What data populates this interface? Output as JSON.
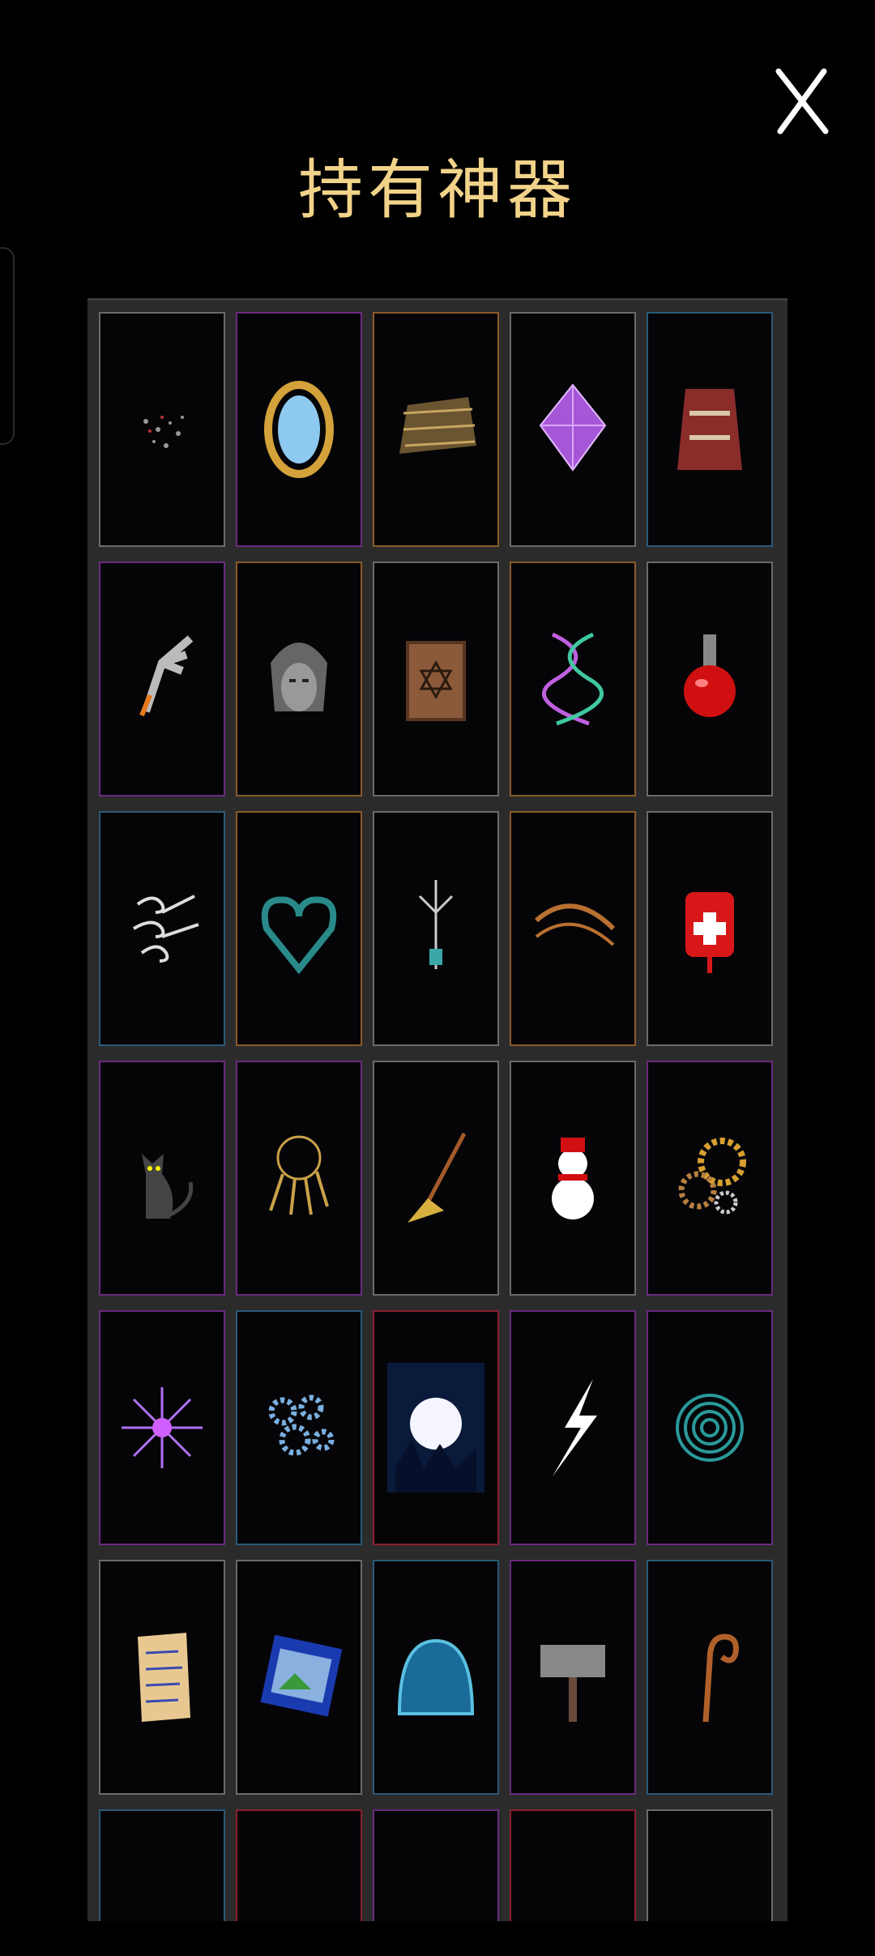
{
  "title": "持有神器",
  "close_icon": "close-x-icon",
  "colors": {
    "title": "#f2d38a",
    "grey": "#6a6a6a",
    "purple": "#6a2a80",
    "orange": "#8a5a2a",
    "blue": "#2a5a78",
    "red": "#8a2030"
  },
  "artifacts": [
    {
      "icon": "dust-cloud-icon",
      "rarity": "grey"
    },
    {
      "icon": "mirror-icon",
      "rarity": "purple"
    },
    {
      "icon": "straw-nest-icon",
      "rarity": "orange"
    },
    {
      "icon": "purple-crystal-icon",
      "rarity": "grey"
    },
    {
      "icon": "tattered-robe-icon",
      "rarity": "blue"
    },
    {
      "icon": "metal-gauntlet-icon",
      "rarity": "purple"
    },
    {
      "icon": "stone-mask-icon",
      "rarity": "orange"
    },
    {
      "icon": "hexagram-book-icon",
      "rarity": "grey"
    },
    {
      "icon": "dna-helix-icon",
      "rarity": "orange"
    },
    {
      "icon": "red-potion-icon",
      "rarity": "grey"
    },
    {
      "icon": "wind-swirl-icon",
      "rarity": "blue"
    },
    {
      "icon": "thorny-heart-icon",
      "rarity": "orange"
    },
    {
      "icon": "antenna-tower-icon",
      "rarity": "grey"
    },
    {
      "icon": "rune-arc-icon",
      "rarity": "orange"
    },
    {
      "icon": "blood-bag-icon",
      "rarity": "grey"
    },
    {
      "icon": "black-cat-icon",
      "rarity": "purple"
    },
    {
      "icon": "key-ring-icon",
      "rarity": "purple"
    },
    {
      "icon": "broom-icon",
      "rarity": "grey"
    },
    {
      "icon": "snowman-icon",
      "rarity": "grey"
    },
    {
      "icon": "golden-gears-icon",
      "rarity": "purple"
    },
    {
      "icon": "purple-spike-orb-icon",
      "rarity": "purple"
    },
    {
      "icon": "blue-gears-icon",
      "rarity": "blue"
    },
    {
      "icon": "full-moon-icon",
      "rarity": "red"
    },
    {
      "icon": "lightning-bolt-icon",
      "rarity": "purple"
    },
    {
      "icon": "spiral-vortex-icon",
      "rarity": "purple"
    },
    {
      "icon": "paper-scroll-icon",
      "rarity": "grey"
    },
    {
      "icon": "painting-icon",
      "rarity": "grey"
    },
    {
      "icon": "blue-dome-icon",
      "rarity": "blue"
    },
    {
      "icon": "war-hammer-icon",
      "rarity": "purple"
    },
    {
      "icon": "crook-staff-icon",
      "rarity": "blue"
    },
    {
      "icon": "partial-card-icon",
      "rarity": "blue"
    },
    {
      "icon": "partial-card-icon",
      "rarity": "red"
    },
    {
      "icon": "partial-card-icon",
      "rarity": "purple"
    },
    {
      "icon": "partial-card-icon",
      "rarity": "red"
    },
    {
      "icon": "partial-card-icon",
      "rarity": "grey"
    }
  ]
}
